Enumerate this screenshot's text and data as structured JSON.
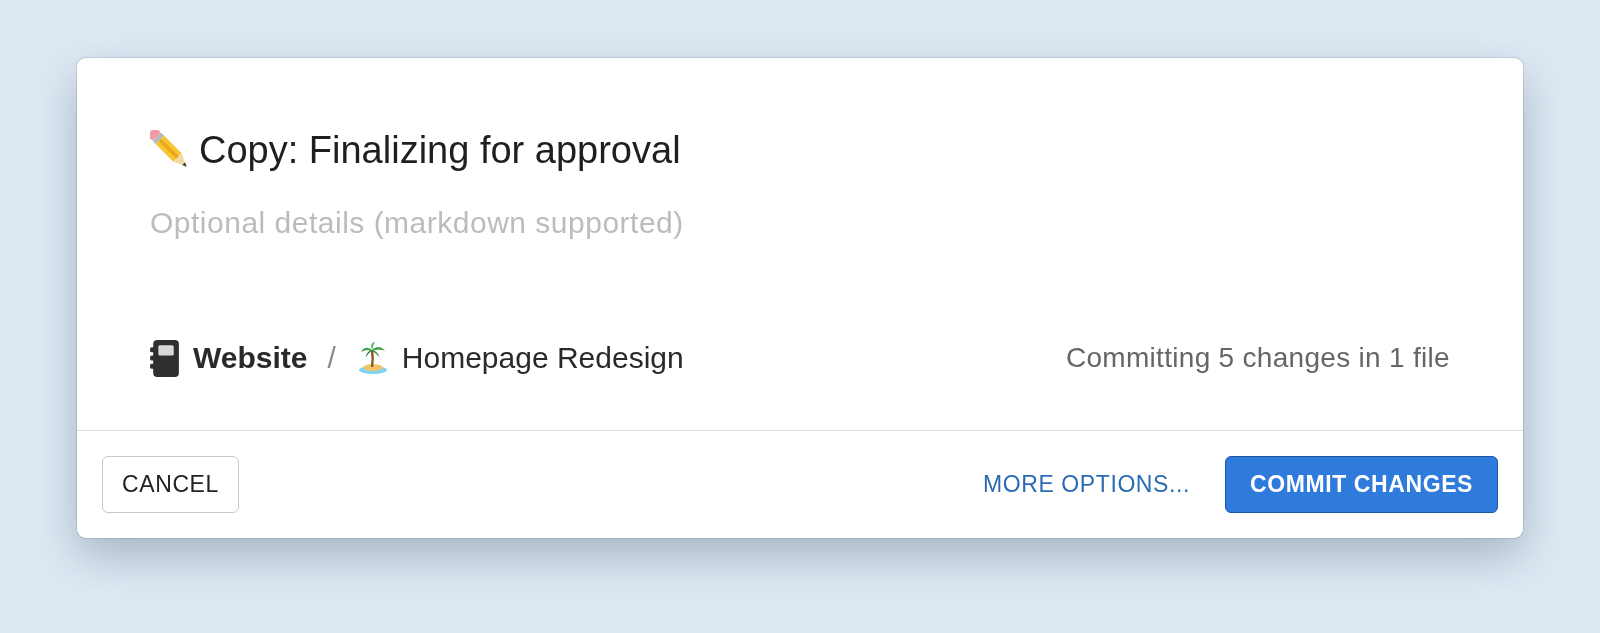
{
  "dialog": {
    "title": {
      "value": "Copy: Finalizing for approval"
    },
    "details": {
      "placeholder": "Optional details (markdown supported)"
    },
    "breadcrumb": {
      "items": [
        {
          "kind": "project",
          "label": "Website"
        },
        {
          "kind": "branch",
          "label": "Homepage Redesign"
        }
      ],
      "separator": "/"
    },
    "summary": "Committing 5 changes in 1 file",
    "buttons": [
      {
        "kind": "secondary",
        "label": "CANCEL"
      },
      {
        "kind": "link",
        "label": "MORE OPTIONS..."
      },
      {
        "kind": "primary",
        "label": "COMMIT CHANGES"
      }
    ]
  }
}
